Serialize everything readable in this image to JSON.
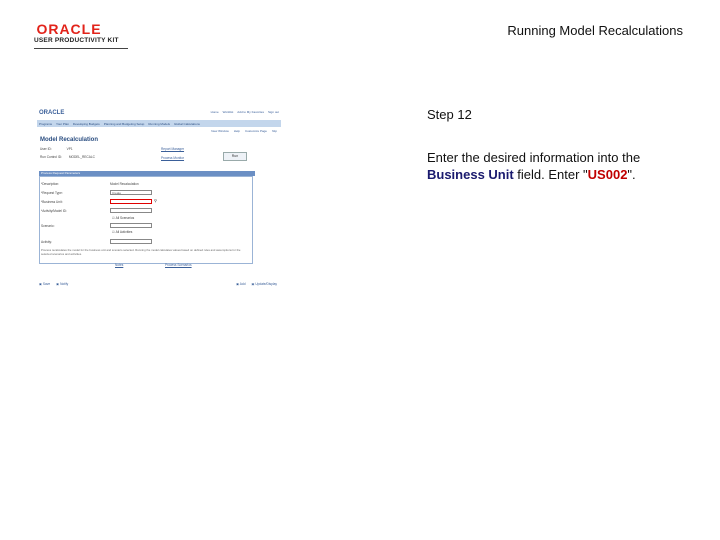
{
  "header": {
    "logo_brand": "ORACLE",
    "logo_sub": "USER PRODUCTIVITY KIT",
    "page_title": "Running Model Recalculations"
  },
  "step": {
    "title": "Step 12",
    "instruction_pre": "Enter the desired information into the ",
    "field_name": "Business Unit",
    "instruction_mid": " field. Enter \"",
    "value": "US002",
    "instruction_post": "\"."
  },
  "screenshot": {
    "logo": "ORACLE",
    "header_links": [
      "Home",
      "Worklist",
      "Add to My Favorites",
      "Sign out"
    ],
    "nav_items": [
      "Programs",
      "Your Plan",
      "Developing Budgets",
      "Planning and Budgeting Setup",
      "Running Models",
      "Global Calculations"
    ],
    "toolbar": [
      "New Window",
      "Help",
      "Customize Page",
      "http"
    ],
    "page_title": "Model Recalculation",
    "user_id_label": "User ID:",
    "user_id_value": "VP1",
    "run_control_label": "Run Control ID:",
    "run_control_value": "MODEL_RECALC",
    "report_manager": "Report Manager",
    "process_monitor": "Process Monitor",
    "run_label": "Run",
    "section_title": "Process Request Parameters",
    "fields": [
      {
        "label": "*Description:",
        "value": "Model Recalculation"
      },
      {
        "label": "*Request Type:",
        "value": "Create"
      },
      {
        "label": "*Business Unit:",
        "value": ""
      },
      {
        "label": "*Activity/Model ID:",
        "value": ""
      }
    ],
    "checkbox_1": "All Scenarios",
    "scenario_label": "Scenario:",
    "checkbox_2": "All Activities",
    "activity_label": "Activity:",
    "paragraph": "Process recalculates the model for the business unit and scenario selected. Running the model calculates values based on defined rules and assumptions for the selected scenarios and activities.",
    "notes_link": "Notes",
    "process_link": "Process Scenarios",
    "save": "Save",
    "notify": "Notify",
    "add": "Add",
    "update": "Update/Display"
  }
}
